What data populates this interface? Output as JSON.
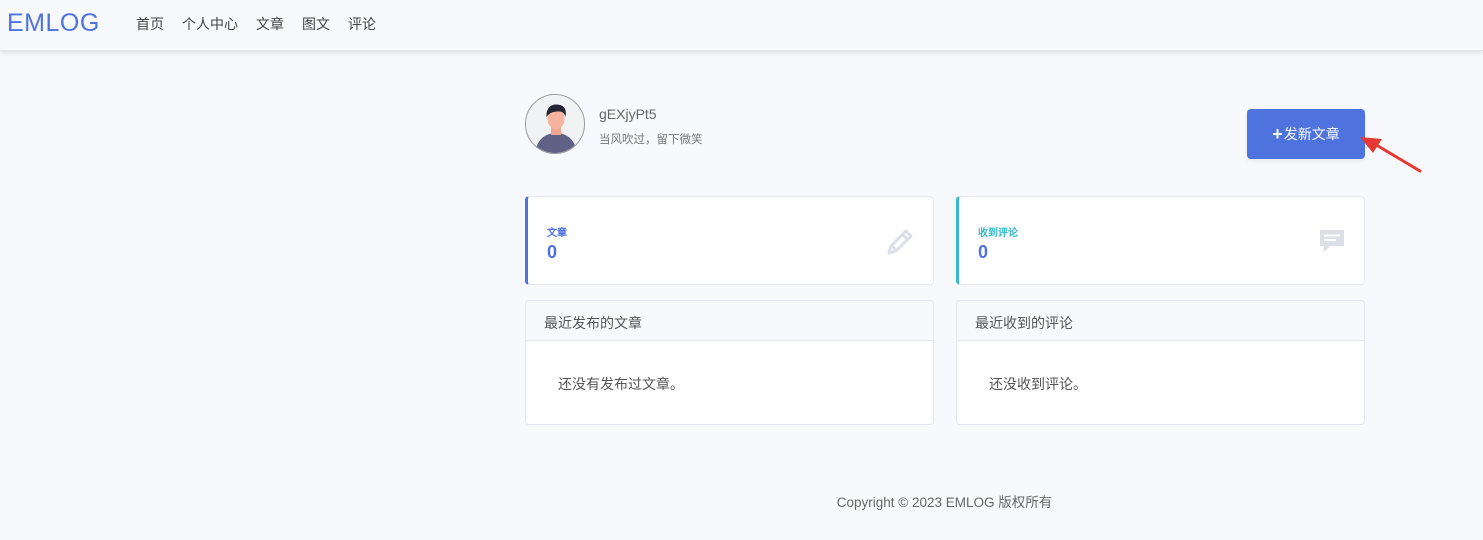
{
  "brand": "EMLOG",
  "nav": [
    "首页",
    "个人中心",
    "文章",
    "图文",
    "评论"
  ],
  "profile": {
    "username": "gEXjyPt5",
    "motto": "当风吹过，留下微笑"
  },
  "new_post_button": {
    "icon": "plus-icon",
    "label": "发新文章"
  },
  "stats": {
    "posts": {
      "label": "文章",
      "count": "0",
      "icon": "pencil-icon",
      "accent": "#4e73df"
    },
    "comments": {
      "label": "收到评论",
      "count": "0",
      "icon": "comment-icon",
      "accent": "#36b9cc"
    }
  },
  "panels": {
    "recent_posts": {
      "title": "最近发布的文章",
      "empty": "还没有发布过文章。"
    },
    "recent_comments": {
      "title": "最近收到的评论",
      "empty": "还没收到评论。"
    }
  },
  "footer": "Copyright © 2023 EMLOG 版权所有",
  "colors": {
    "primary": "#4e73df",
    "info": "#36b9cc",
    "annotation_arrow": "#e53935"
  }
}
